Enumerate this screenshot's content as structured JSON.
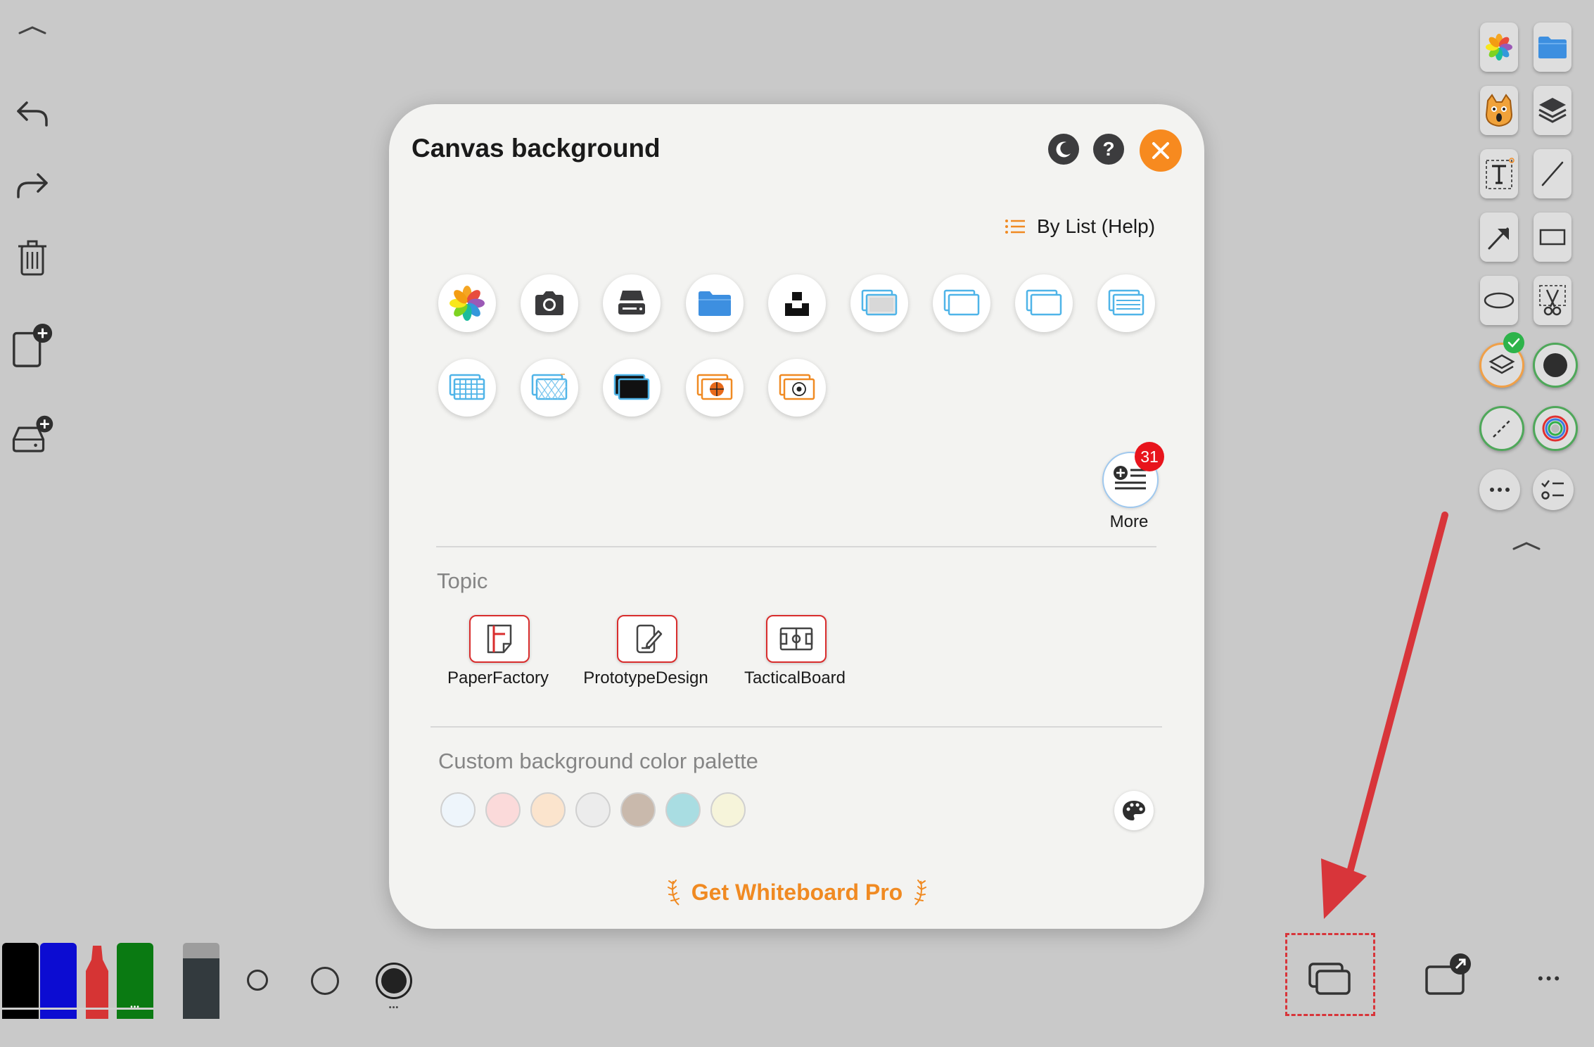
{
  "dialog": {
    "title": "Canvas background",
    "help_label": "?",
    "by_list_label": "By List (Help)",
    "more_label": "More",
    "more_badge": "31",
    "topic_section": "Topic",
    "topics": [
      "PaperFactory",
      "PrototypeDesign",
      "TacticalBoard"
    ],
    "palette_section": "Custom background color palette",
    "palette_colors": [
      "#eef5fb",
      "#fbdada",
      "#fbe4cd",
      "#ececec",
      "#c9b9ac",
      "#a9dde2",
      "#f6f4da"
    ],
    "pro_label": "Get Whiteboard Pro",
    "background_buttons": [
      "photos-icon",
      "camera-icon",
      "scanner-icon",
      "folder-icon",
      "unsplash-icon",
      "dotted-board-icon",
      "blank-board-icon",
      "blank-board-icon",
      "lined-board-icon",
      "grid-board-icon",
      "isometric-board-icon",
      "blackboard-icon",
      "basketball-board-icon",
      "soccer-board-icon"
    ]
  },
  "toolbar_colors": {
    "accent": "#f78a1f",
    "marker_black": "#000000",
    "marker_blue": "#0c0cd2",
    "marker_red": "#d63434",
    "marker_green": "#0a7a12",
    "annotation": "#d8353a"
  },
  "bottom_right": {
    "more_dots": "•••"
  },
  "bottom_left": {
    "pen_more": "•••",
    "width_more": "•••"
  }
}
